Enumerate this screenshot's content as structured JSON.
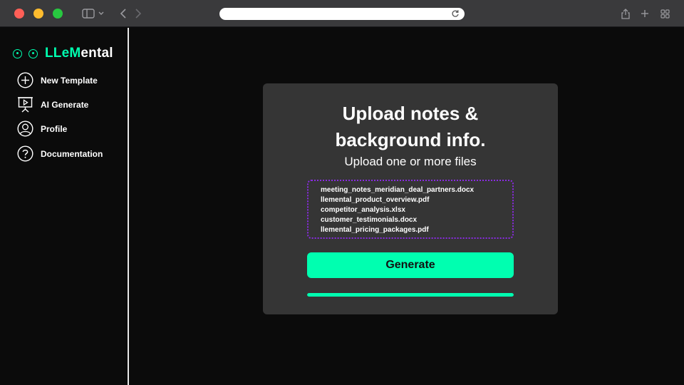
{
  "app": {
    "brand_accent": "LLeM",
    "brand_rest": "ental",
    "accent_color": "#00ffb0",
    "dropzone_border_color": "#8a2be2"
  },
  "sidebar": {
    "items": [
      {
        "label": "New Template",
        "icon": "plus-circle-icon"
      },
      {
        "label": "AI Generate",
        "icon": "presentation-icon"
      },
      {
        "label": "Profile",
        "icon": "user-circle-icon"
      },
      {
        "label": "Documentation",
        "icon": "question-circle-icon"
      }
    ]
  },
  "upload": {
    "title_line1": "Upload notes &",
    "title_line2": "background info.",
    "subtitle": "Upload one or more files",
    "files": [
      "meeting_notes_meridian_deal_partners.docx",
      "llemental_product_overview.pdf",
      "competitor_analysis.xlsx",
      "customer_testimonials.docx",
      "llemental_pricing_packages.pdf"
    ],
    "generate_label": "Generate",
    "progress": 1.0
  }
}
